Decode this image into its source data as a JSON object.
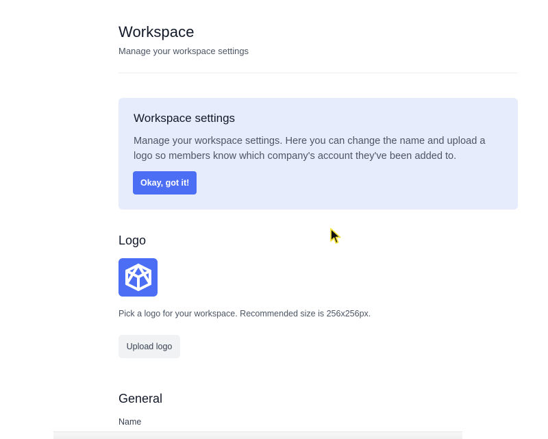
{
  "header": {
    "title": "Workspace",
    "subtitle": "Manage your workspace settings"
  },
  "banner": {
    "title": "Workspace settings",
    "text": "Manage your workspace settings. Here you can change the name and upload a logo so members know which company's account they've been added to.",
    "button_label": "Okay, got it!"
  },
  "logo_section": {
    "title": "Logo",
    "logo_icon": "cube-icon",
    "help_text": "Pick a logo for your workspace. Recommended size is 256x256px.",
    "upload_label": "Upload logo"
  },
  "general_section": {
    "title": "General",
    "name_label": "Name"
  },
  "colors": {
    "accent": "#4c6ef5",
    "banner_bg": "#e7ecfd"
  }
}
